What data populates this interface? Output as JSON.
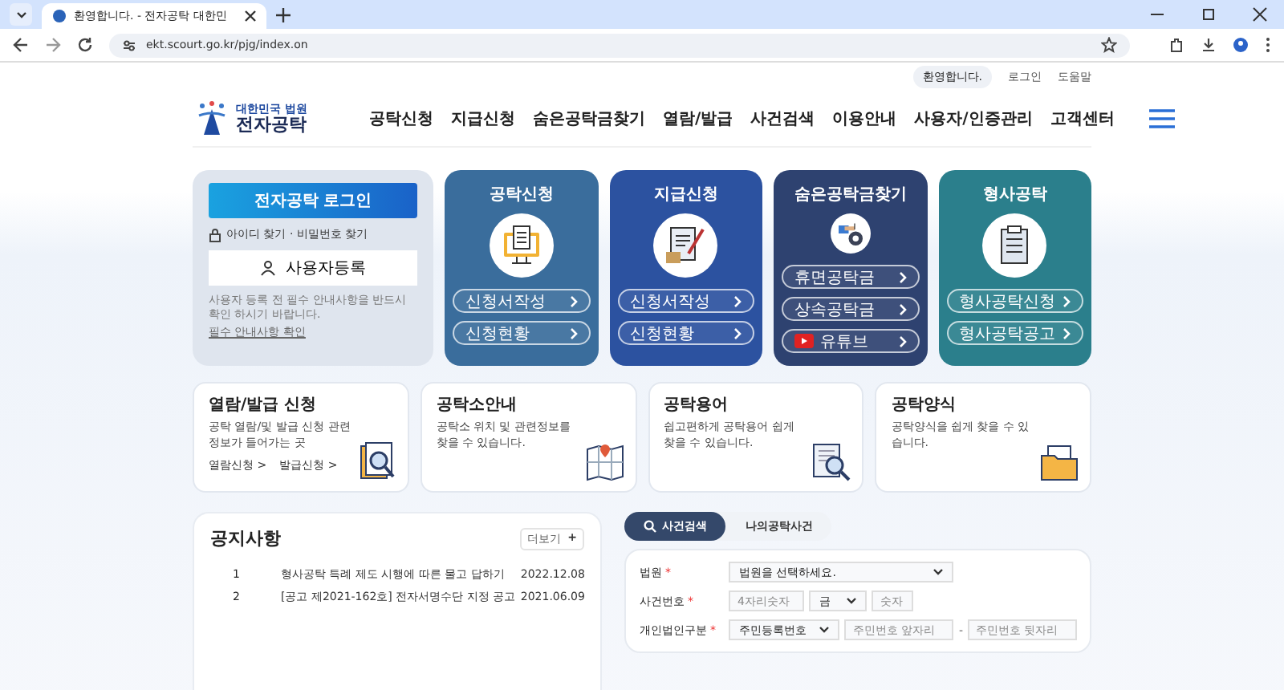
{
  "browser": {
    "tab_title": "환영합니다. - 전자공탁 대한민",
    "url": "ekt.scourt.go.kr/pjg/index.on"
  },
  "utility_bar": {
    "welcome": "환영합니다.",
    "links": [
      "로그인",
      "도움말"
    ]
  },
  "logo": {
    "subtitle": "대한민국 법원",
    "title": "전자공탁"
  },
  "nav": [
    "공탁신청",
    "지급신청",
    "숨은공탁금찾기",
    "열람/발급",
    "사건검색",
    "이용안내",
    "사용자/인증관리",
    "고객센터"
  ],
  "login_card": {
    "login_button": "전자공탁 로그인",
    "find_link": "아이디 찾기 · 비밀번호 찾기",
    "register_button": "사용자등록",
    "note": "사용자 등록 전 필수 안내사항을 반드시 확인 하시기 바랍니다.",
    "note_link": "필수 안내사항 확인"
  },
  "services": [
    {
      "title": "공탁신청",
      "kind": "monitor",
      "color": "#3a6d9c",
      "links": [
        {
          "label": "신청서작성",
          "kind": "link"
        },
        {
          "label": "신청현황",
          "kind": "link"
        }
      ]
    },
    {
      "title": "지급신청",
      "kind": "document",
      "color": "#2c52a0",
      "links": [
        {
          "label": "신청서작성",
          "kind": "link"
        },
        {
          "label": "신청현황",
          "kind": "link"
        }
      ]
    },
    {
      "title": "숨은공탁금찾기",
      "kind": "money",
      "color": "#2e4270",
      "links": [
        {
          "label": "휴면공탁금",
          "kind": "link"
        },
        {
          "label": "상속공탁금",
          "kind": "link"
        },
        {
          "label": "유튜브",
          "kind": "video"
        }
      ]
    },
    {
      "title": "형사공탁",
      "kind": "clipboard",
      "color": "#2b7f8c",
      "links": [
        {
          "label": "형사공탁신청",
          "kind": "link"
        },
        {
          "label": "형사공탁공고",
          "kind": "link"
        }
      ]
    }
  ],
  "info_cards": [
    {
      "title": "열람/발급 신청",
      "kind": "search-doc",
      "description": "공탁 열람/및 발급 신청 관련 정보가 들어가는 곳",
      "links": [
        "열람신청 >",
        "발급신청 >"
      ]
    },
    {
      "title": "공탁소안내",
      "kind": "map",
      "description": "공탁소 위치 및 관련정보를 찾을 수 있습니다."
    },
    {
      "title": "공탁용어",
      "kind": "magnifier",
      "description": "쉽고편하게 공탁용어 쉽게 찾을 수 있습니다."
    },
    {
      "title": "공탁양식",
      "kind": "folder",
      "description": "공탁양식을 쉽게 찾을 수 있습니다."
    }
  ],
  "notice": {
    "title": "공지사항",
    "more": "더보기",
    "more_icon": "+",
    "rows": [
      {
        "number": "1",
        "title": "형사공탁 특례 제도 시행에 따른 물고 답하기",
        "date": "2022.12.08"
      },
      {
        "number": "2",
        "title": "[공고 제2021-162호] 전자서명수단 지정 공고",
        "date": "2021.06.09"
      }
    ]
  },
  "case_search": {
    "tabs": [
      {
        "label": "사건검색",
        "selected": true
      },
      {
        "label": "나의공탁사건",
        "selected": false
      }
    ],
    "fields": [
      {
        "label": "법원",
        "required_mark": "*",
        "controls": [
          {
            "kind": "select",
            "value": "법원을 선택하세요."
          }
        ]
      },
      {
        "label": "사건번호",
        "required_mark": "*",
        "controls": [
          {
            "kind": "input",
            "placeholder": "4자리숫자"
          },
          {
            "kind": "select",
            "value": "금"
          },
          {
            "kind": "input",
            "placeholder": "숫자"
          }
        ]
      },
      {
        "label": "개인법인구분",
        "required_mark": "*",
        "controls": [
          {
            "kind": "select",
            "value": "주민등록번호"
          },
          {
            "kind": "input",
            "placeholder": "주민번호 앞자리"
          },
          {
            "kind": "separator",
            "text": "-"
          },
          {
            "kind": "input",
            "placeholder": "주민번호 뒷자리"
          }
        ]
      }
    ]
  }
}
